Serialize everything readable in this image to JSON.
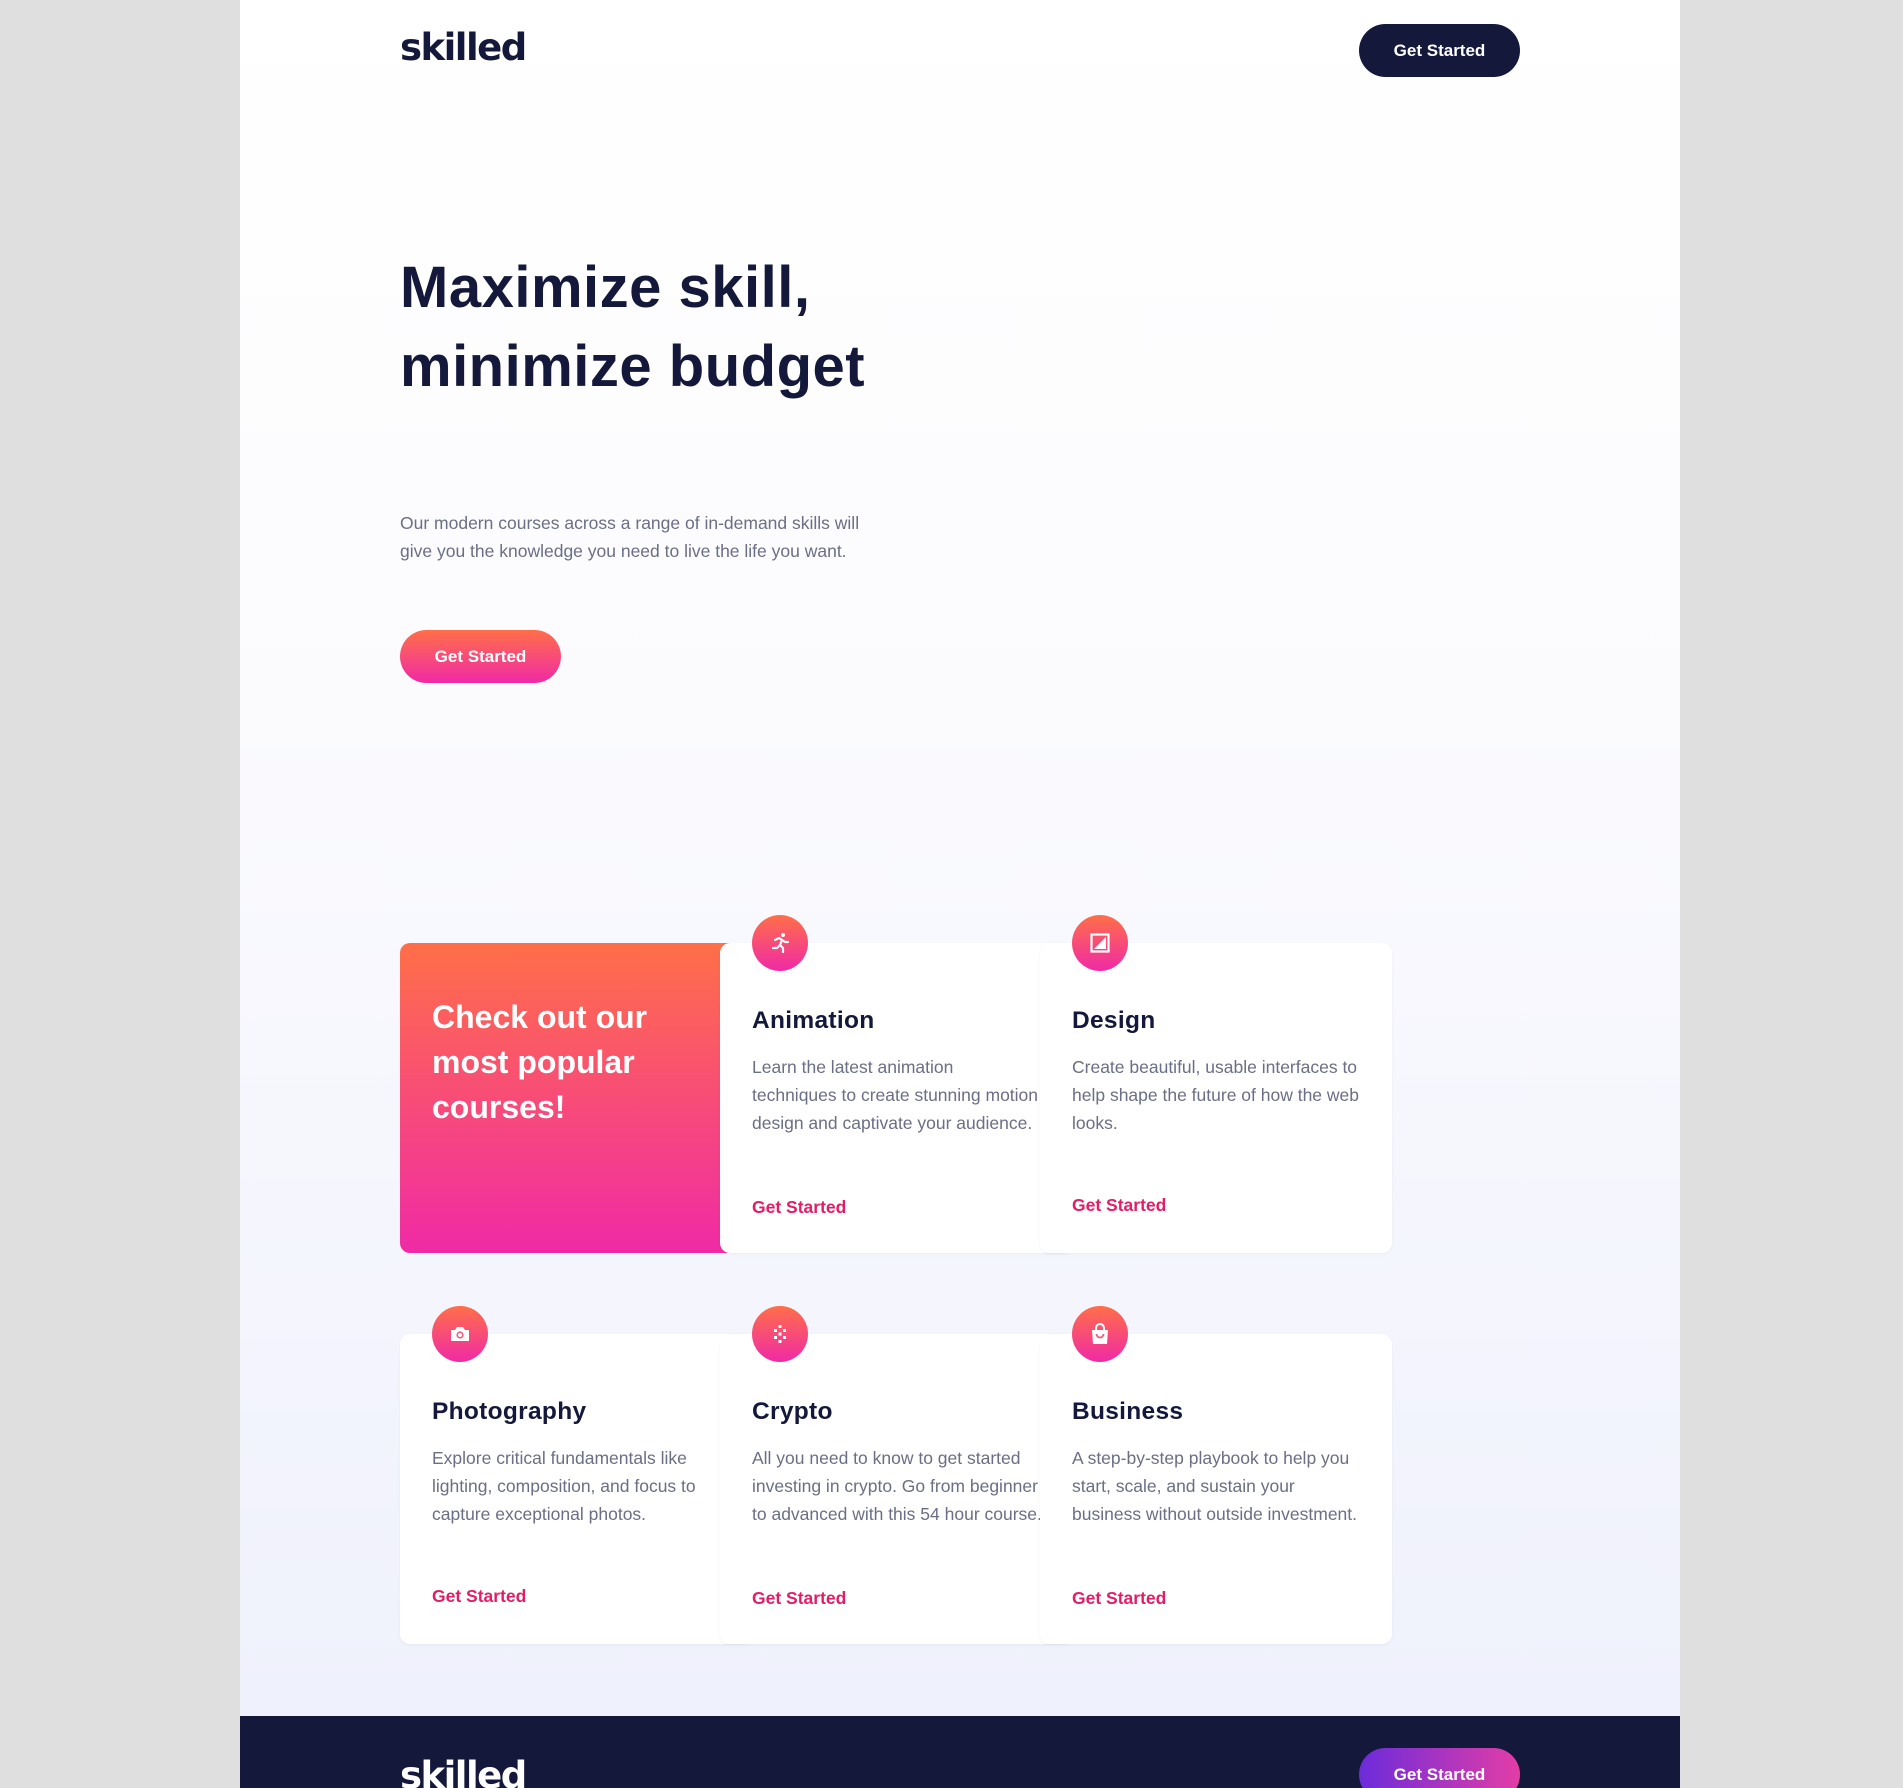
{
  "header": {
    "logo": "skilled",
    "cta_label": "Get Started"
  },
  "hero": {
    "title": "Maximize skill, minimize budget",
    "text": "Our modern courses across a range of in-demand skills will give you the knowledge you need to live the life you want.",
    "cta_label": "Get Started"
  },
  "promo": {
    "title": "Check out our most popular courses!"
  },
  "courses": [
    {
      "title": "Animation",
      "icon": "running-figure-icon",
      "description": "Learn the latest animation techniques to create stunning motion design and captivate your audience.",
      "link": "Get Started"
    },
    {
      "title": "Design",
      "icon": "design-frame-icon",
      "description": "Create beautiful, usable interfaces to help shape the future of how the web looks.",
      "link": "Get Started"
    },
    {
      "title": "Photography",
      "icon": "camera-icon",
      "description": "Explore critical fundamentals like lighting, composition, and focus to capture exceptional photos.",
      "link": "Get Started"
    },
    {
      "title": "Crypto",
      "icon": "crypto-pixels-icon",
      "description": "All you need to know to get started investing in crypto. Go from beginner to advanced with this 54 hour course.",
      "link": "Get Started"
    },
    {
      "title": "Business",
      "icon": "shopping-bag-icon",
      "description": "A step-by-step playbook to help you start, scale, and sustain your business without outside investment.",
      "link": "Get Started"
    }
  ],
  "footer": {
    "logo": "skilled",
    "cta_label": "Get Started"
  },
  "colors": {
    "navy": "#14183a",
    "accent_pink": "#e21d67",
    "gradient_start": "#ff6f48",
    "gradient_end": "#f02aa6",
    "text_grey": "#6b6e85"
  }
}
